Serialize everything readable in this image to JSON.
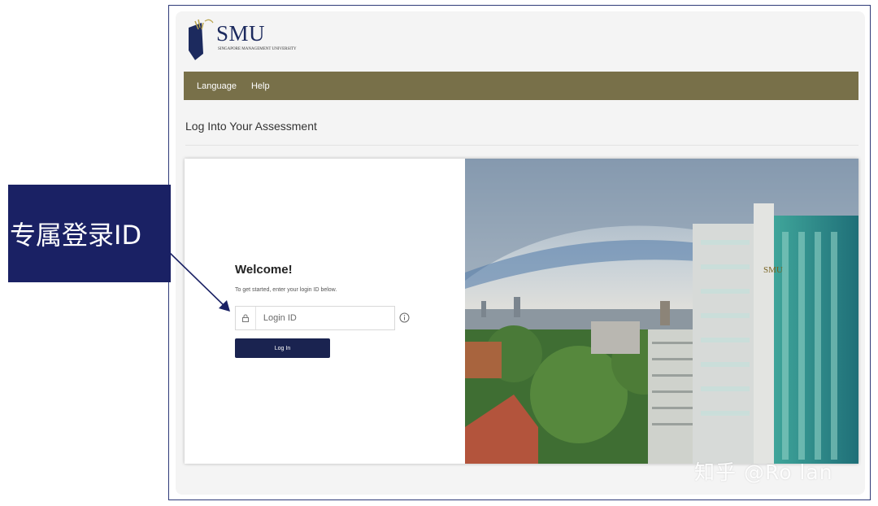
{
  "logo": {
    "wordmark": "SMU",
    "subtitle": "Singapore Management University"
  },
  "nav": {
    "items": [
      {
        "label": "Language"
      },
      {
        "label": "Help"
      }
    ],
    "bar_color": "#787049"
  },
  "page": {
    "title": "Log Into Your Assessment"
  },
  "login": {
    "heading": "Welcome!",
    "instructions": "To get started, enter your login ID below.",
    "placeholder": "Login ID",
    "button_label": "Log In",
    "button_color": "#1a2350"
  },
  "annotation": {
    "label": "专属登录ID"
  },
  "watermark": "知乎 @Ro lan",
  "icons": [
    "smu-logo-icon",
    "lock-icon",
    "info-icon",
    "arrow-icon"
  ]
}
